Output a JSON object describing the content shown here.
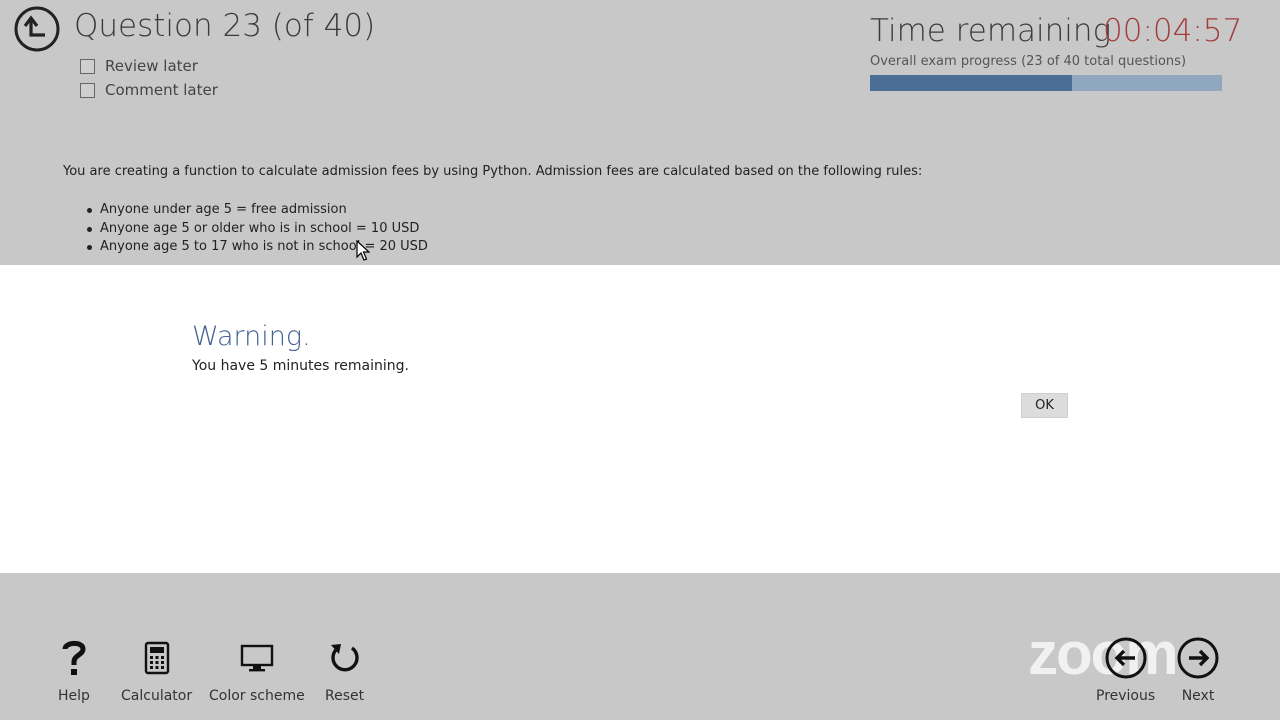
{
  "header": {
    "question_title": "Question 23 (of 40)",
    "review_later_label": "Review later",
    "comment_later_label": "Comment later",
    "time_label": "Time remaining",
    "time_value": "00:04:57",
    "progress_label": "Overall exam progress (23 of 40 total questions)",
    "progress_fraction": 0.575
  },
  "question": {
    "intro": "You are creating a function to calculate admission fees by using Python. Admission fees are calculated based on the following rules:",
    "rules": [
      "Anyone under age 5 = free admission",
      "Anyone age 5 or older who is in school = 10 USD",
      "Anyone age 5 to 17 who is not in school = 20 USD"
    ]
  },
  "modal": {
    "title": "Warning.",
    "message": "You have 5 minutes remaining.",
    "ok_label": "OK"
  },
  "toolbar": {
    "help_label": "Help",
    "calculator_label": "Calculator",
    "color_scheme_label": "Color scheme",
    "reset_label": "Reset",
    "previous_label": "Previous",
    "next_label": "Next"
  },
  "watermark": {
    "text": "zoom"
  },
  "icons": {
    "back": "back-up-arrow-icon",
    "help": "question-mark-icon",
    "calculator": "calculator-icon",
    "color_scheme": "monitor-icon",
    "reset": "reset-icon",
    "previous": "arrow-left-circle-icon",
    "next": "arrow-right-circle-icon"
  },
  "colors": {
    "timer": "#a33c3c",
    "modal_title": "#3e5f90",
    "progress_fill": "#4a6e96",
    "progress_track": "#8fa8c0"
  }
}
